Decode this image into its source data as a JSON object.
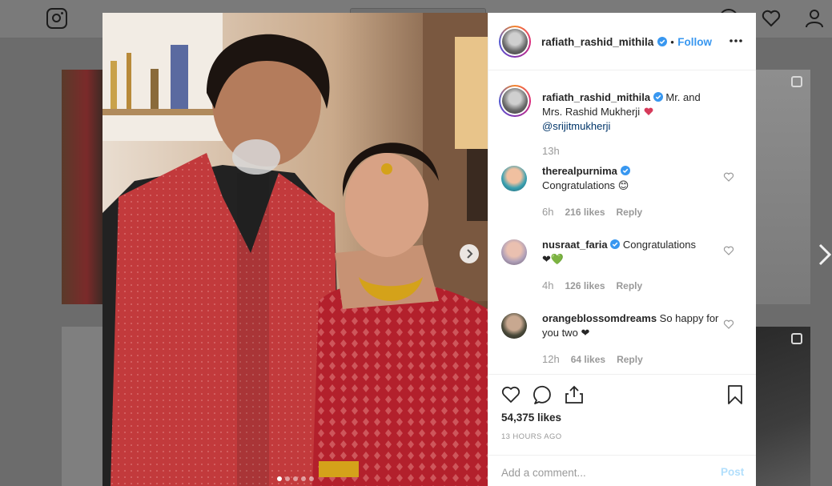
{
  "background": {
    "search_placeholder": ""
  },
  "post": {
    "username": "rafiath_rashid_mithila",
    "follow_label": "Follow",
    "separator": "•",
    "caption": "Mr. and Mrs. Rashid Mukherji",
    "caption_mention": "@srijitmukherji",
    "caption_time": "13h",
    "carousel": {
      "count": 5,
      "active": 0
    },
    "likes": "54,375 likes",
    "posted_ago": "13 HOURS AGO",
    "comment_placeholder": "Add a comment...",
    "post_label": "Post"
  },
  "comments": [
    {
      "username": "therealpurnima",
      "verified": true,
      "text": "Congratulations",
      "emoji": "😊",
      "time": "6h",
      "likes": "216 likes",
      "reply": "Reply"
    },
    {
      "username": "nusraat_faria",
      "verified": true,
      "text": "Congratulations",
      "emoji": "❤💚",
      "time": "4h",
      "likes": "126 likes",
      "reply": "Reply"
    },
    {
      "username": "orangeblossomdreams",
      "verified": false,
      "text": "So happy for you two",
      "emoji": "❤",
      "time": "12h",
      "likes": "64 likes",
      "reply": "Reply"
    }
  ],
  "colors": {
    "link": "#3897f0",
    "verified": "#3897f0",
    "mention": "#003569",
    "muted": "#999999"
  }
}
